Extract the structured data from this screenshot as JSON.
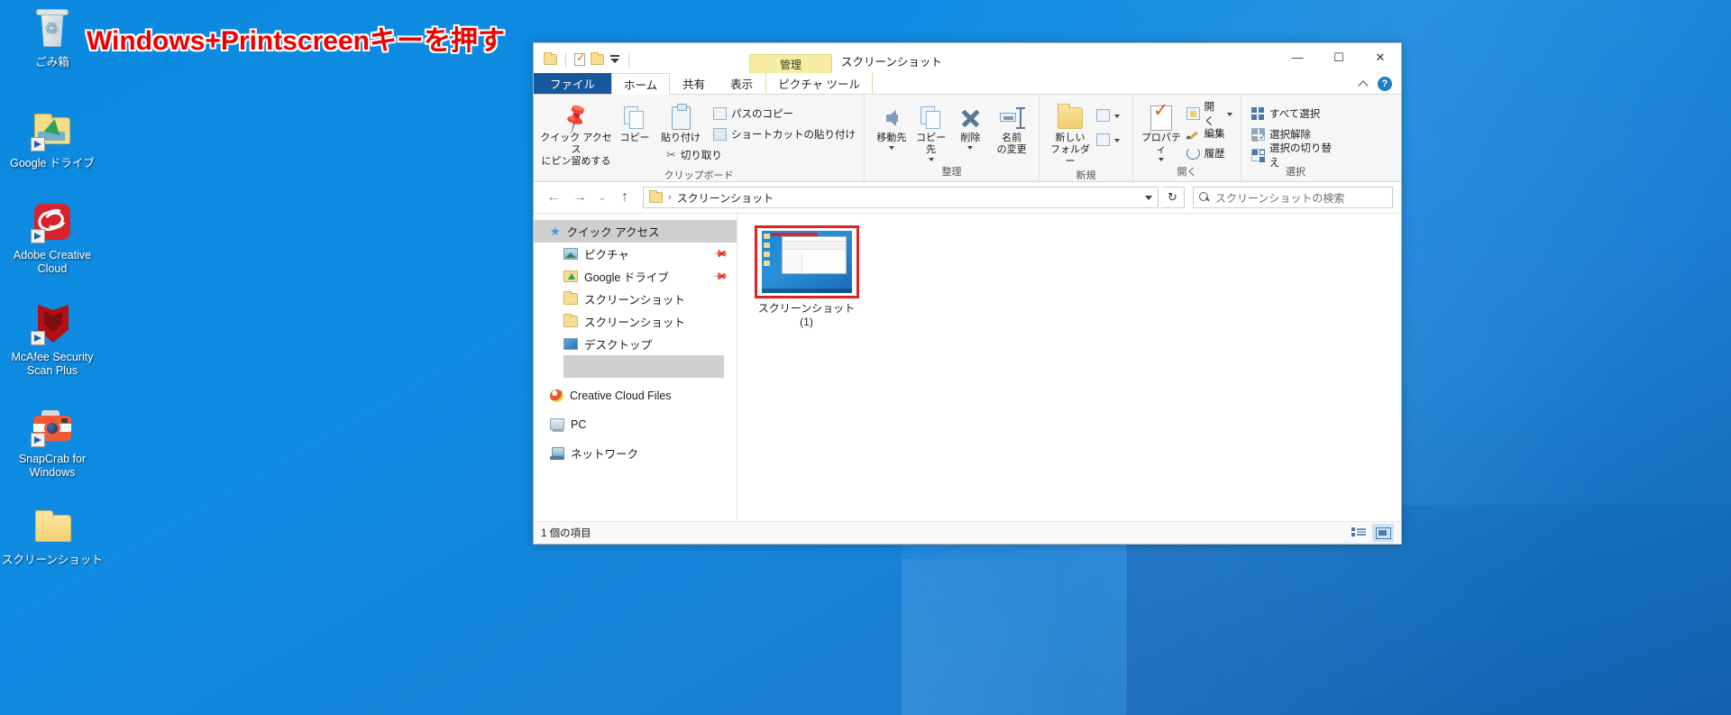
{
  "annotation": {
    "text": "Windows+Printscreenキーを押す",
    "color": "#ee0000"
  },
  "desktop": {
    "icons": [
      {
        "id": "recycle-bin",
        "label": "ごみ箱"
      },
      {
        "id": "google-drive",
        "label": "Google ドライブ"
      },
      {
        "id": "adobe-cc",
        "label": "Adobe Creative Cloud"
      },
      {
        "id": "mcafee",
        "label": "McAfee Security Scan Plus"
      },
      {
        "id": "snapcrab",
        "label": "SnapCrab for Windows"
      },
      {
        "id": "screenshots",
        "label": "スクリーンショット"
      }
    ]
  },
  "explorer": {
    "titlebar": {
      "contextual_header": "管理",
      "window_title": "スクリーンショット",
      "quick_access_icons": [
        "folder-icon",
        "properties-icon",
        "new-folder-icon",
        "customize-qat-icon"
      ],
      "controls": {
        "minimize": "—",
        "maximize": "☐",
        "close": "✕"
      }
    },
    "tabs": [
      {
        "id": "file",
        "label": "ファイル",
        "state": "file"
      },
      {
        "id": "home",
        "label": "ホーム",
        "state": "active"
      },
      {
        "id": "share",
        "label": "共有",
        "state": "normal"
      },
      {
        "id": "view",
        "label": "表示",
        "state": "normal"
      },
      {
        "id": "picture",
        "label": "ピクチャ ツール",
        "state": "contextual"
      }
    ],
    "tabstrip_right": {
      "collapse_icon": "chevron-up-icon",
      "help_label": "?"
    },
    "ribbon": {
      "groups": [
        {
          "id": "clipboard",
          "label": "クリップボード",
          "big_buttons": [
            {
              "id": "pin-quick-access",
              "label1": "クイック アクセス",
              "label2": "にピン留めする",
              "icon": "pin-icon"
            },
            {
              "id": "copy",
              "label1": "コピー",
              "label2": "",
              "icon": "copy-icon"
            },
            {
              "id": "paste",
              "label1": "貼り付け",
              "label2": "",
              "icon": "clipboard-icon"
            }
          ],
          "small_buttons": [
            {
              "id": "copy-path",
              "label": "パスのコピー",
              "icon": "copy-path-icon"
            },
            {
              "id": "paste-shortcut",
              "label": "ショートカットの貼り付け",
              "icon": "paste-shortcut-icon"
            },
            {
              "id": "cut",
              "label": "切り取り",
              "icon": "scissors-icon"
            }
          ]
        },
        {
          "id": "organize",
          "label": "整理",
          "big_buttons": [
            {
              "id": "move-to",
              "label1": "移動先",
              "label2": "",
              "icon": "arrow-left-icon",
              "caret": true
            },
            {
              "id": "copy-to",
              "label1": "コピー先",
              "label2": "",
              "icon": "copy-to-icon",
              "caret": true
            },
            {
              "id": "delete",
              "label1": "削除",
              "label2": "",
              "icon": "delete-x-icon",
              "caret": true
            },
            {
              "id": "rename",
              "label1": "名前",
              "label2": "の変更",
              "icon": "rename-icon",
              "caret": false
            }
          ]
        },
        {
          "id": "new",
          "label": "新規",
          "big_buttons": [
            {
              "id": "new-folder",
              "label1": "新しい",
              "label2": "フォルダー",
              "icon": "new-folder-icon",
              "caret": false
            }
          ],
          "small_buttons": [
            {
              "id": "new-item",
              "label": "",
              "icon": "new-item-icon",
              "caret": true
            },
            {
              "id": "easy-access",
              "label": "",
              "icon": "easy-access-icon",
              "caret": true
            }
          ]
        },
        {
          "id": "open",
          "label": "開く",
          "big_buttons": [
            {
              "id": "properties",
              "label1": "プロパティ",
              "label2": "",
              "icon": "properties-icon",
              "caret": true
            }
          ],
          "small_buttons": [
            {
              "id": "open",
              "label": "開く",
              "icon": "open-icon",
              "caret": true
            },
            {
              "id": "edit",
              "label": "編集",
              "icon": "pencil-icon",
              "caret": false
            },
            {
              "id": "history",
              "label": "履歴",
              "icon": "history-icon",
              "caret": false
            }
          ]
        },
        {
          "id": "select",
          "label": "選択",
          "small_buttons": [
            {
              "id": "select-all",
              "label": "すべて選択",
              "icon": "select-all-icon"
            },
            {
              "id": "select-none",
              "label": "選択解除",
              "icon": "select-none-icon"
            },
            {
              "id": "invert-selection",
              "label": "選択の切り替え",
              "icon": "invert-selection-icon"
            }
          ]
        }
      ]
    },
    "addressbar": {
      "back_icon": "arrow-left-icon",
      "forward_icon": "arrow-right-icon",
      "recent_icon": "chevron-down-icon",
      "up_icon": "arrow-up-icon",
      "path_icon": "folder-icon",
      "path_separator": "›",
      "path_text": "スクリーンショット",
      "dropdown_icon": "chevron-down-icon",
      "refresh_icon": "↻",
      "search_placeholder": "スクリーンショットの検索",
      "search_value": "",
      "search_icon": "search-icon"
    },
    "sidebar": {
      "items": [
        {
          "id": "quick-access",
          "label": "クイック アクセス",
          "icon": "star-icon",
          "selected": true,
          "indent": false,
          "pinned": false
        },
        {
          "id": "pictures",
          "label": "ピクチャ",
          "icon": "picture-icon",
          "selected": false,
          "indent": true,
          "pinned": true
        },
        {
          "id": "google-drive",
          "label": "Google ドライブ",
          "icon": "gdrive-icon",
          "selected": false,
          "indent": true,
          "pinned": true
        },
        {
          "id": "screenshots-1",
          "label": "スクリーンショット",
          "icon": "folder-icon",
          "selected": false,
          "indent": true,
          "pinned": false
        },
        {
          "id": "screenshots-2",
          "label": "スクリーンショット",
          "icon": "folder-icon",
          "selected": false,
          "indent": true,
          "pinned": false
        },
        {
          "id": "desktop",
          "label": "デスクトップ",
          "icon": "desktop-icon",
          "selected": false,
          "indent": true,
          "pinned": false
        },
        {
          "id": "blank-item",
          "label": "",
          "icon": "none",
          "selected": false,
          "indent": true,
          "pinned": false
        },
        {
          "id": "creative-cloud",
          "label": "Creative Cloud Files",
          "icon": "cc-icon",
          "selected": false,
          "indent": false,
          "pinned": false
        },
        {
          "id": "pc",
          "label": "PC",
          "icon": "pc-icon",
          "selected": false,
          "indent": false,
          "pinned": false
        },
        {
          "id": "network",
          "label": "ネットワーク",
          "icon": "network-icon",
          "selected": false,
          "indent": false,
          "pinned": false
        }
      ]
    },
    "content": {
      "files": [
        {
          "id": "screenshot-1",
          "label": "スクリーンショット(1)",
          "selected": true,
          "highlight_color": "#dd2222"
        }
      ]
    },
    "statusbar": {
      "item_count": "1 個の項目",
      "view_buttons": [
        {
          "id": "details-view",
          "icon": "details-view-icon",
          "active": false
        },
        {
          "id": "large-icons-view",
          "icon": "large-icons-view-icon",
          "active": true
        }
      ]
    }
  }
}
